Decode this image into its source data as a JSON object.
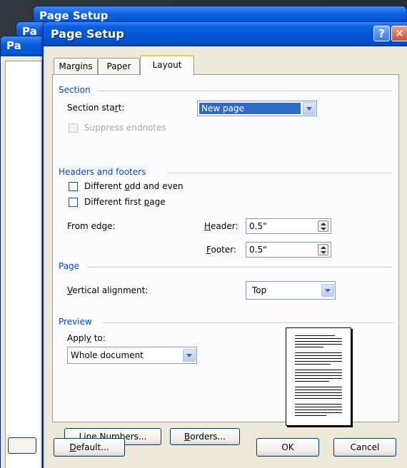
{
  "window": {
    "title": "Page Setup",
    "help": "?",
    "close": "✕"
  },
  "ghost": {
    "title_full": "Page Setup",
    "title_partial": "Pa"
  },
  "tabs": [
    {
      "label": "Margins",
      "active": false
    },
    {
      "label": "Paper",
      "active": false
    },
    {
      "label": "Layout",
      "active": true
    }
  ],
  "section": {
    "legend": "Section",
    "start_label_pre": "Section sta",
    "start_label_key": "r",
    "start_label_post": "t:",
    "start_value": "New page",
    "suppress_label": "Suppress endnotes",
    "suppress_checked": false
  },
  "headers": {
    "legend": "Headers and footers",
    "odd_even_pre": "Different ",
    "odd_even_key": "o",
    "odd_even_post": "dd and even",
    "first_page_pre": "Different first ",
    "first_page_key": "p",
    "first_page_post": "age",
    "from_edge": "From edge:",
    "header_key": "H",
    "header_post": "eader:",
    "header_value": "0.5\"",
    "footer_key": "F",
    "footer_post": "ooter:",
    "footer_value": "0.5\""
  },
  "page": {
    "legend": "Page",
    "valign_key": "V",
    "valign_post": "ertical alignment:",
    "valign_value": "Top"
  },
  "preview": {
    "legend": "Preview",
    "apply_pre": "Appl",
    "apply_key": "y",
    "apply_post": " to:",
    "apply_value": "Whole document"
  },
  "buttons": {
    "line_numbers_pre": "Line ",
    "line_numbers_key": "N",
    "line_numbers_post": "umbers...",
    "borders_key": "B",
    "borders_post": "orders...",
    "default_key": "D",
    "default_post": "efault...",
    "ok": "OK",
    "cancel": "Cancel"
  },
  "colors": {
    "accent": "#0046d5",
    "titlebar": "#0355d4",
    "tab_highlight": "#ffc83c"
  }
}
